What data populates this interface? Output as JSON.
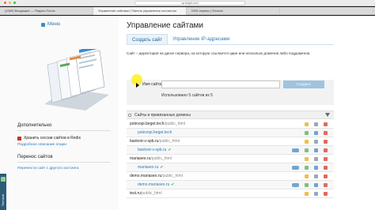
{
  "browser": {
    "url": "cp.beget.com",
    "tabs": [
      {
        "label": "(2369) Входящие — Яндекс.Почта",
        "active": false
      },
      {
        "label": "Управление сайтами | Панель управления хостингом",
        "active": true
      },
      {
        "label": "DNS-сервер | Sirvenic",
        "active": false
      },
      {
        "label": "",
        "active": false
      }
    ]
  },
  "sidebar": {
    "menu_label": "Меню",
    "additional_heading": "Дополнительно",
    "store_sessions_label": "Хранить сессии сайтов в Redis",
    "store_sessions_link": "Подробное описание опции",
    "transfer_heading": "Перенос сайтов",
    "transfer_link": "Перенести сайт с другого хостинга"
  },
  "terminal_panel": {
    "label": "Terminal"
  },
  "main": {
    "title": "Управление сайтами",
    "tabs": [
      {
        "label": "Создать сайт",
        "active": true
      },
      {
        "label": "Управление IP-адресами",
        "active": false
      }
    ],
    "description": "Сайт – директория на диске сервера, на которую ссылается один или несколько доменов либо поддоменов.",
    "form": {
      "name_label": "Имя сайта:",
      "name_value": "",
      "name_placeholder": "",
      "create_button": "Создать",
      "used_count": "Использовано 5 сайтов из 5"
    },
    "table": {
      "heading": "Сайты и привязанные домены",
      "rows": [
        {
          "type": "site",
          "name": "polevopi.beget.tech",
          "path": "/public_html"
        },
        {
          "type": "domain",
          "name": "polevopi.beget.tech",
          "path": "",
          "check": false
        },
        {
          "type": "site",
          "name": "bankrot-v-spb.ru",
          "path": "/public_html"
        },
        {
          "type": "domain",
          "name": "bankrot-v-spb.ru",
          "path": "",
          "check": true
        },
        {
          "type": "site",
          "name": "mariaseo.ru",
          "path": "/public_html"
        },
        {
          "type": "domain",
          "name": "mariaseo.ru",
          "path": "",
          "check": true
        },
        {
          "type": "site",
          "name": "demo.mariaseo.ru",
          "path": "/public_html"
        },
        {
          "type": "domain",
          "name": "demo.mariaseo.ru",
          "path": "",
          "check": true
        },
        {
          "type": "site",
          "name": "test.ru",
          "path": "/public_html"
        }
      ]
    }
  },
  "colors": {
    "link": "#2b7ab9",
    "button": "#9fc3e0",
    "check": "#3aa04a",
    "danger": "#e06a5c",
    "terminal": "#2d5b78"
  }
}
